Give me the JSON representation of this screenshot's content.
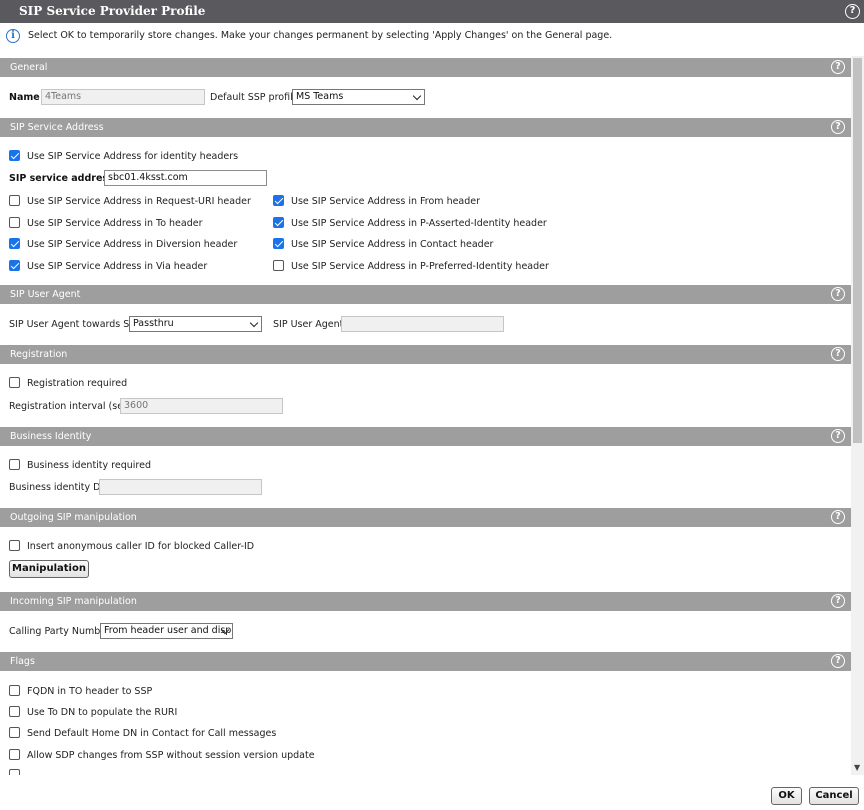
{
  "window": {
    "title": "SIP Service Provider Profile",
    "help_glyph": "?"
  },
  "info": {
    "text": "Select OK to temporarily store changes. Make your changes permanent by selecting 'Apply Changes' on the General page.",
    "icon_glyph": "i"
  },
  "sections": {
    "general": "General",
    "sip_service_address": "SIP Service Address",
    "sip_user_agent": "SIP User Agent",
    "registration": "Registration",
    "business_identity": "Business Identity",
    "outgoing_sip": "Outgoing SIP manipulation",
    "incoming_sip": "Incoming SIP manipulation",
    "flags": "Flags"
  },
  "general": {
    "name_label": "Name",
    "name_value": "4Teams",
    "default_ssp_label": "Default SSP profile",
    "default_ssp_value": "MS Teams"
  },
  "sip_service_address": {
    "use_identity_label": "Use SIP Service Address for identity headers",
    "use_identity_checked": true,
    "address_label": "SIP service address",
    "address_value": "sbc01.4ksst.com",
    "options": [
      {
        "label": "Use SIP Service Address in Request-URI header",
        "checked": false
      },
      {
        "label": "Use SIP Service Address in From header",
        "checked": true
      },
      {
        "label": "Use SIP Service Address in To header",
        "checked": false
      },
      {
        "label": "Use SIP Service Address in P-Asserted-Identity header",
        "checked": true
      },
      {
        "label": "Use SIP Service Address in Diversion header",
        "checked": true
      },
      {
        "label": "Use SIP Service Address in Contact header",
        "checked": true
      },
      {
        "label": "Use SIP Service Address in Via header",
        "checked": true
      },
      {
        "label": "Use SIP Service Address in P-Preferred-Identity header",
        "checked": false
      }
    ]
  },
  "sip_user_agent": {
    "towards_label": "SIP User Agent towards SSP",
    "towards_value": "Passthru",
    "agent_label": "SIP User Agent",
    "agent_value": ""
  },
  "registration": {
    "required_label": "Registration required",
    "required_checked": false,
    "interval_label": "Registration interval (sec)",
    "interval_value": "3600"
  },
  "business_identity": {
    "required_label": "Business identity required",
    "required_checked": false,
    "dn_label": "Business identity DN",
    "dn_value": ""
  },
  "outgoing": {
    "anon_label": "Insert anonymous caller ID for blocked Caller-ID",
    "anon_checked": false,
    "manipulation_button": "Manipulation"
  },
  "incoming": {
    "calling_party_label": "Calling Party Number",
    "calling_party_value": "From header user and disp"
  },
  "flags": [
    {
      "label": "FQDN in TO header to SSP",
      "checked": false
    },
    {
      "label": "Use To DN to populate the RURI",
      "checked": false
    },
    {
      "label": "Send Default Home DN in Contact for Call messages",
      "checked": false
    },
    {
      "label": "Allow SDP changes from SSP without session version update",
      "checked": false
    }
  ],
  "footer": {
    "ok_label": "OK",
    "cancel_label": "Cancel"
  }
}
